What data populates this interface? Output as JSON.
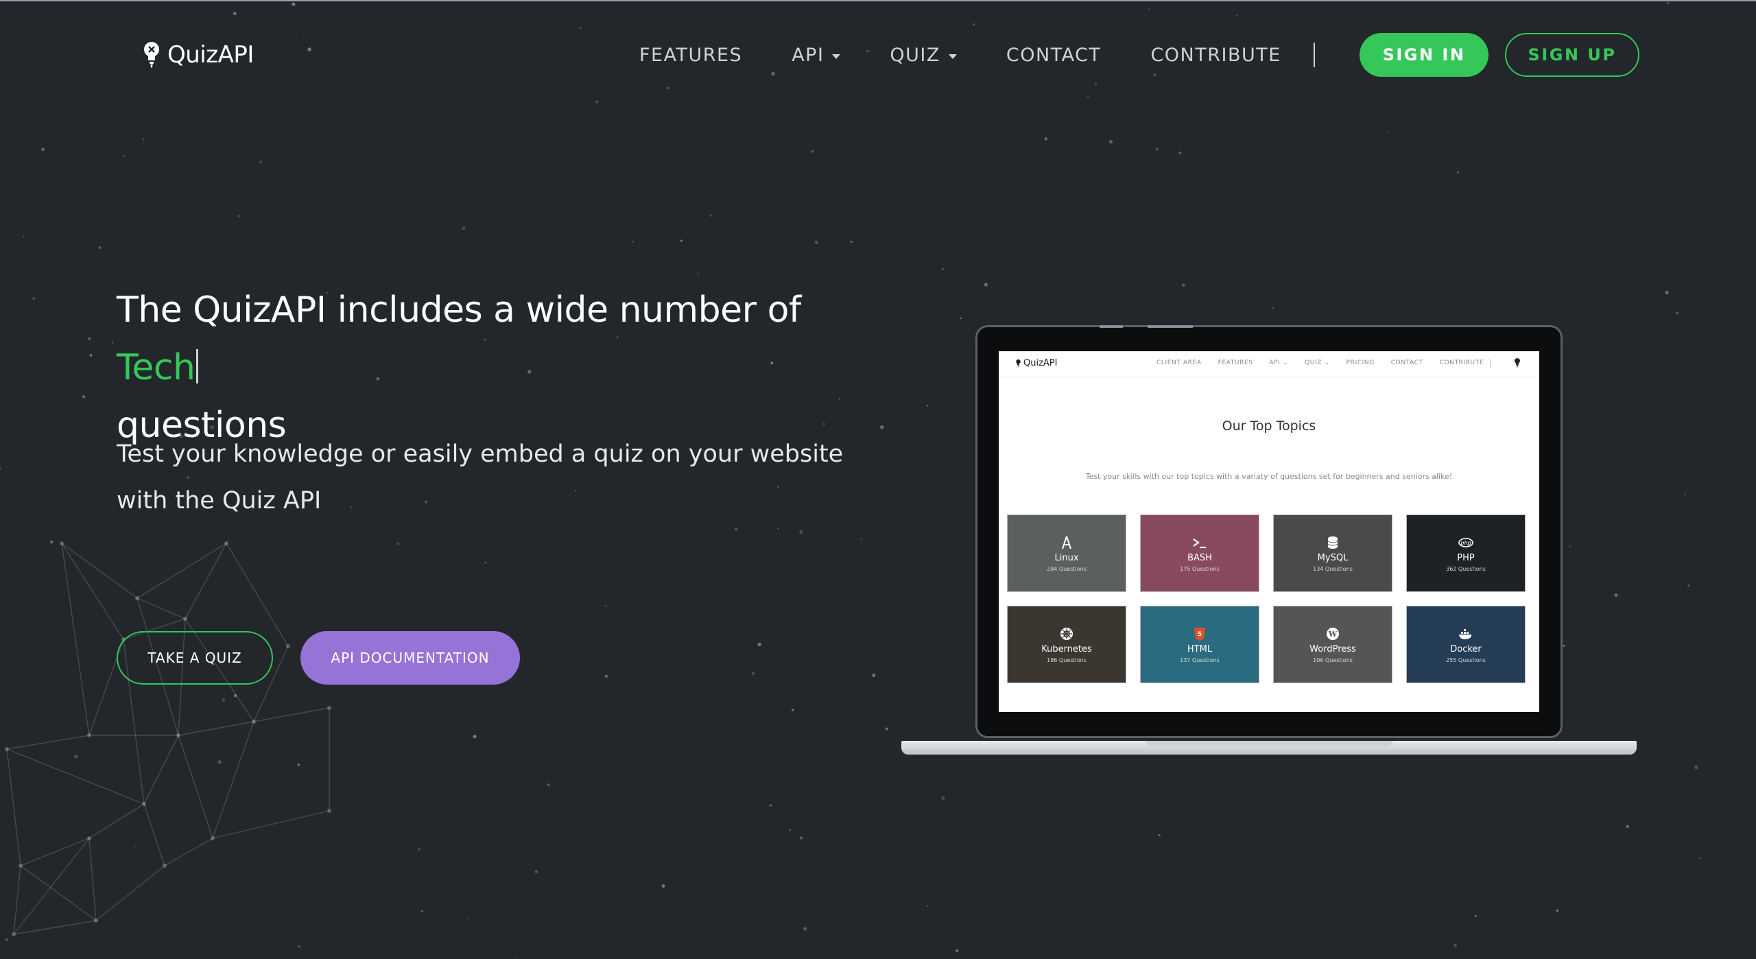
{
  "brand": {
    "name": "QuizAPI"
  },
  "nav": {
    "features": "FEATURES",
    "api": "API",
    "quiz": "QUIZ",
    "contact": "CONTACT",
    "contribute": "CONTRIBUTE",
    "sign_in": "SIGN IN",
    "sign_up": "SIGN UP"
  },
  "hero": {
    "title_before": "The QuizAPI includes a wide number of ",
    "title_accent": "Tech",
    "title_after": "questions",
    "subtitle": "Test your knowledge or easily embed a quiz on your website with the Quiz API",
    "take_quiz": "TAKE A QUIZ",
    "api_docs": "API DOCUMENTATION"
  },
  "preview": {
    "logo": "QuizAPI",
    "nav": [
      "CLIENT AREA",
      "FEATURES",
      "API ⌄",
      "QUIZ ⌄",
      "PRICING",
      "CONTACT",
      "CONTRIBUTE"
    ],
    "heading": "Our Top Topics",
    "description": "Test your skills with our top topics with a variaty of questions set for beginners and seniors alike!",
    "topics": [
      {
        "name": "Linux",
        "count": "284 Questions",
        "icon": "linux-icon",
        "color": "#5b5f60"
      },
      {
        "name": "BASH",
        "count": "175 Questions",
        "icon": "terminal-icon",
        "color": "#8a4a5d"
      },
      {
        "name": "MySQL",
        "count": "134 Questions",
        "icon": "database-icon",
        "color": "#4a4a48"
      },
      {
        "name": "PHP",
        "count": "362 Questions",
        "icon": "php-icon",
        "color": "#1f2224"
      },
      {
        "name": "Kubernetes",
        "count": "186 Questions",
        "icon": "kubernetes-icon",
        "color": "#3b3730"
      },
      {
        "name": "HTML",
        "count": "137 Questions",
        "icon": "html5-icon",
        "color": "#2b6b7f"
      },
      {
        "name": "WordPress",
        "count": "106 Questions",
        "icon": "wordpress-icon",
        "color": "#555555"
      },
      {
        "name": "Docker",
        "count": "255 Questions",
        "icon": "docker-icon",
        "color": "#243c54"
      }
    ]
  },
  "colors": {
    "background": "#23272b",
    "accent_green": "#35c759",
    "accent_purple": "#9673d6"
  }
}
